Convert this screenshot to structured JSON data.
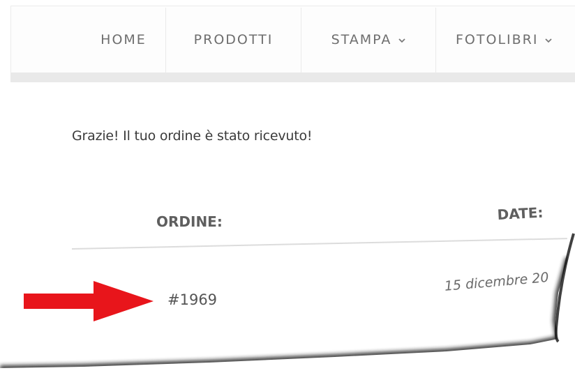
{
  "nav": {
    "items": [
      {
        "label": "HOME",
        "has_dropdown": false
      },
      {
        "label": "PRODOTTI",
        "has_dropdown": false
      },
      {
        "label": "STAMPA",
        "has_dropdown": true
      },
      {
        "label": "FOTOLIBRI",
        "has_dropdown": true
      }
    ],
    "dropdown_icon": "chevron-down-icon",
    "chevron_glyph": "⌄"
  },
  "content": {
    "thanks_message": "Grazie! Il tuo ordine è stato ricevuto!",
    "columns": {
      "order_label": "ORDINE:",
      "date_label": "DATE:"
    },
    "order": {
      "number": "#1969",
      "date": "15 dicembre 20"
    }
  },
  "annotation": {
    "icon": "arrow-right-icon",
    "color": "#e8151b"
  },
  "colors": {
    "nav_text": "#6e6e6e",
    "body_text": "#3a3a3a",
    "header_text": "#5f5f5f",
    "nav_band": "#e9e9e9"
  }
}
